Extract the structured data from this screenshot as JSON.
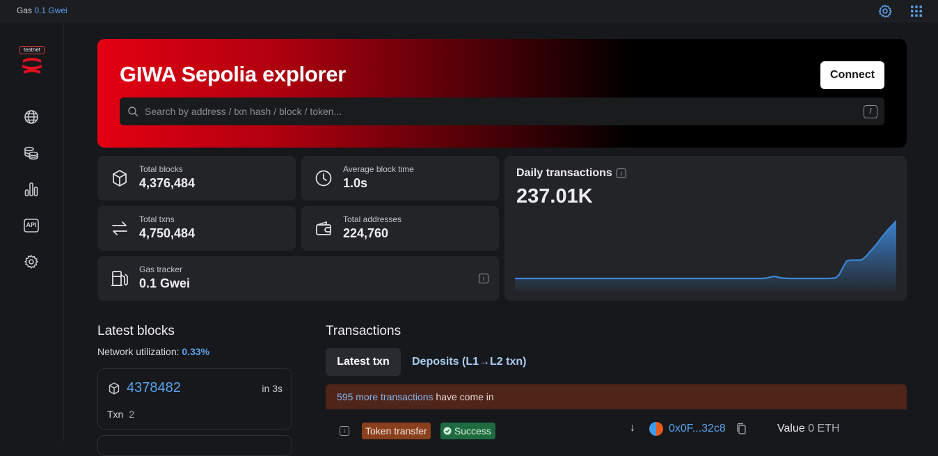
{
  "topbar": {
    "gas_label": "Gas",
    "gas_value": "0.1 Gwei",
    "icons": [
      "settings-icon",
      "apps-grid-icon"
    ]
  },
  "sidebar": {
    "logo_tag": "testnet",
    "icons": [
      "globe-icon",
      "coins-icon",
      "bar-chart-icon",
      "api-icon",
      "settings-icon"
    ],
    "api_text": "API"
  },
  "hero": {
    "title": "GIWA Sepolia explorer",
    "connect_label": "Connect",
    "search_placeholder": "Search by address / txn hash / block / token...",
    "search_shortcut": "/"
  },
  "stats": {
    "total_blocks": {
      "label": "Total blocks",
      "value": "4,376,484"
    },
    "avg_block_time": {
      "label": "Average block time",
      "value": "1.0s"
    },
    "total_txns": {
      "label": "Total txns",
      "value": "4,750,484"
    },
    "total_addresses": {
      "label": "Total addresses",
      "value": "224,760"
    },
    "gas_tracker": {
      "label": "Gas tracker",
      "value": "0.1 Gwei"
    }
  },
  "daily_tx": {
    "title": "Daily transactions",
    "value": "237.01K",
    "info": "i"
  },
  "chart_data": {
    "type": "area",
    "title": "Daily transactions",
    "x": [
      0,
      5,
      10,
      15,
      20,
      25,
      30,
      35,
      40,
      45,
      50,
      55,
      60,
      65,
      66,
      67,
      68,
      69,
      70,
      72,
      74,
      76,
      78,
      80,
      82,
      84,
      85,
      86,
      87,
      88,
      89,
      90,
      91,
      92,
      93,
      94,
      95,
      96,
      97,
      98,
      99,
      100
    ],
    "values": [
      0,
      0,
      0,
      0,
      0,
      0,
      0,
      0,
      0,
      0,
      0,
      0,
      0,
      0,
      1,
      3,
      5,
      3,
      1,
      0,
      0,
      0,
      0,
      0,
      0,
      1,
      8,
      25,
      40,
      42,
      42,
      42,
      43,
      50,
      60,
      70,
      80,
      92,
      103,
      113,
      122,
      132
    ],
    "ylim": [
      0,
      140
    ],
    "grid": false
  },
  "latest_blocks": {
    "title": "Latest blocks",
    "util_label": "Network utilization:",
    "util_value": "0.33%",
    "items": [
      {
        "number": "4378482",
        "time": "in 3s",
        "txn_label": "Txn",
        "txn_count": "2"
      }
    ]
  },
  "transactions": {
    "title": "Transactions",
    "tabs": [
      "Latest txn",
      "Deposits (L1→L2 txn)"
    ],
    "banner_link": "595 more transactions",
    "banner_rest": " have come in",
    "rows": [
      {
        "type": "Token transfer",
        "status": "Success",
        "address": "0x0F...32c8",
        "value_label": "Value",
        "value": "0 ETH"
      }
    ]
  }
}
